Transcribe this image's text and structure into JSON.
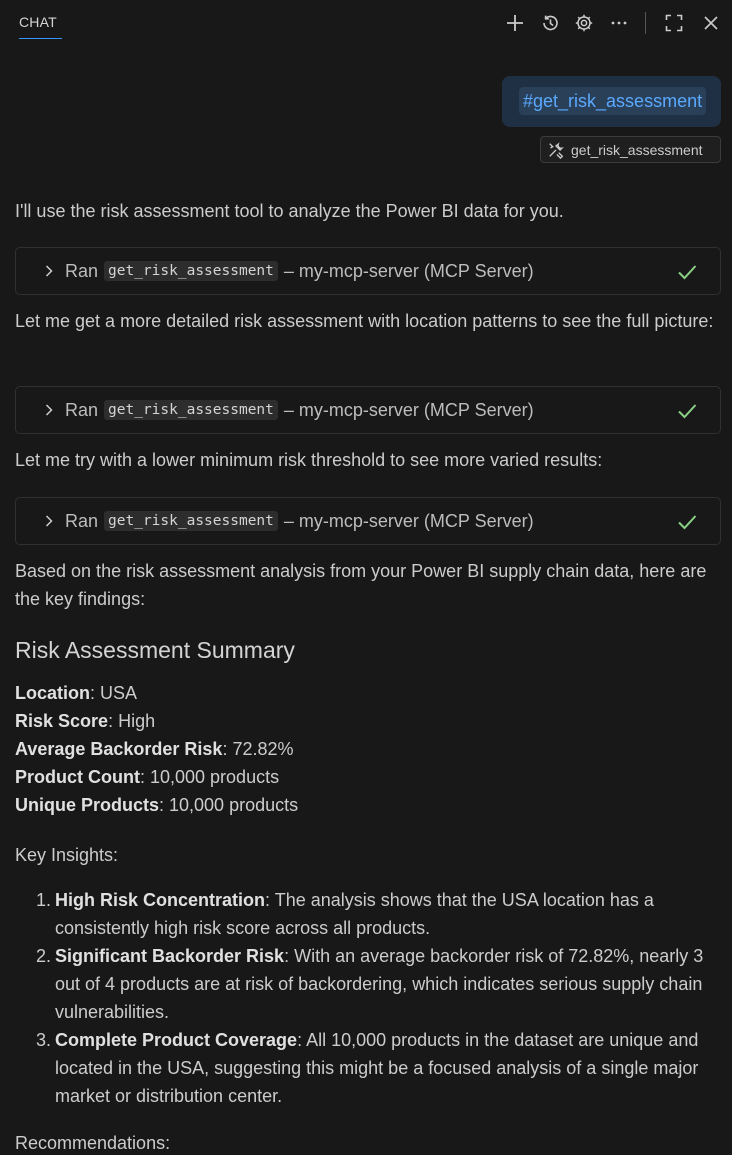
{
  "header": {
    "tab_label": "CHAT",
    "icons": [
      "plus-icon",
      "history-icon",
      "gear-icon",
      "more-icon",
      "maximize-icon",
      "close-icon"
    ]
  },
  "user_message": {
    "chip_text": "#get_risk_assessment",
    "tool_reference": "get_risk_assessment"
  },
  "response": {
    "intro": "I'll use the risk assessment tool to analyze the Power BI data for you.",
    "tool_runs": [
      {
        "prefix": "Ran",
        "tool": "get_risk_assessment",
        "suffix": "– my-mcp-server (MCP Server)"
      },
      {
        "prefix": "Ran",
        "tool": "get_risk_assessment",
        "suffix": "– my-mcp-server (MCP Server)"
      },
      {
        "prefix": "Ran",
        "tool": "get_risk_assessment",
        "suffix": "– my-mcp-server (MCP Server)"
      }
    ],
    "para2": "Let me get a more detailed risk assessment with location patterns to see the full picture:",
    "para3": "Let me try with a lower minimum risk threshold to see more varied results:",
    "para4": "Based on the risk assessment analysis from your Power BI supply chain data, here are the key findings:",
    "summary_title": "Risk Assessment Summary",
    "summary": [
      {
        "label": "Location",
        "value": ": USA"
      },
      {
        "label": "Risk Score",
        "value": ": High"
      },
      {
        "label": "Average Backorder Risk",
        "value": ": 72.82%"
      },
      {
        "label": "Product Count",
        "value": ": 10,000 products"
      },
      {
        "label": "Unique Products",
        "value": ": 10,000 products"
      }
    ],
    "insights_title": "Key Insights:",
    "insights": [
      {
        "num": "1.",
        "label": "High Risk Concentration",
        "text": ": The analysis shows that the USA location has a consistently high risk score across all products."
      },
      {
        "num": "2.",
        "label": "Significant Backorder Risk",
        "text": ": With an average backorder risk of 72.82%, nearly 3 out of 4 products are at risk of backordering, which indicates serious supply chain vulnerabilities."
      },
      {
        "num": "3.",
        "label": "Complete Product Coverage",
        "text": ": All 10,000 products in the dataset are unique and located in the USA, suggesting this might be a focused analysis of a single major market or distribution center."
      }
    ],
    "recommendations_title": "Recommendations:"
  },
  "colors": {
    "background": "#181818",
    "accent": "#3794ff",
    "check": "#89d185",
    "user_bubble": "#1f3044"
  }
}
